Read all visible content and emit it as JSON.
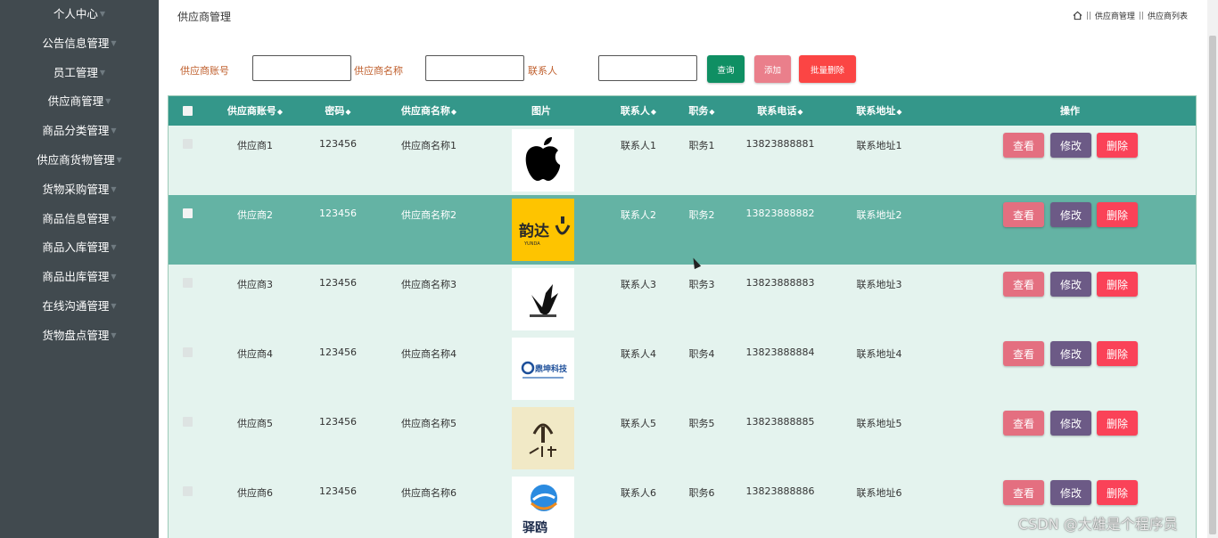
{
  "colors": {
    "sidebar": "#414a4f",
    "header": "#34978a",
    "row_light": "#e4f3ee",
    "row_hover": "#64b3a4",
    "view": "#e46f80",
    "edit": "#6c5a86",
    "delete": "#fa4258",
    "query": "#0f8f63",
    "add": "#ea7f8b",
    "batch_delete": "#fb4544"
  },
  "sidebar": {
    "items": [
      {
        "label": "个人中心"
      },
      {
        "label": "公告信息管理"
      },
      {
        "label": "员工管理"
      },
      {
        "label": "供应商管理"
      },
      {
        "label": "商品分类管理"
      },
      {
        "label": "供应商货物管理"
      },
      {
        "label": "货物采购管理"
      },
      {
        "label": "商品信息管理"
      },
      {
        "label": "商品入库管理"
      },
      {
        "label": "商品出库管理"
      },
      {
        "label": "在线沟通管理"
      },
      {
        "label": "货物盘点管理"
      }
    ]
  },
  "header": {
    "title": "供应商管理",
    "breadcrumb": [
      "供应商管理",
      "供应商列表"
    ],
    "home_icon": "home-icon"
  },
  "search": {
    "account_label": "供应商账号",
    "name_label": "供应商名称",
    "contact_label": "联系人",
    "account_value": "",
    "name_value": "",
    "contact_value": "",
    "query": "查询",
    "add": "添加",
    "batch_delete": "批量删除"
  },
  "table": {
    "columns": [
      "供应商账号",
      "密码",
      "供应商名称",
      "图片",
      "联系人",
      "职务",
      "联系电话",
      "联系地址",
      "操作"
    ],
    "actions": {
      "view": "查看",
      "edit": "修改",
      "delete": "删除"
    },
    "rows": [
      {
        "account": "供应商1",
        "password": "123456",
        "name": "供应商名称1",
        "logo": "apple-logo",
        "contact": "联系人1",
        "title": "职务1",
        "phone": "13823888881",
        "address": "联系地址1"
      },
      {
        "account": "供应商2",
        "password": "123456",
        "name": "供应商名称2",
        "logo": "yunda-logo",
        "logo_text": "韵达",
        "contact": "联系人2",
        "title": "职务2",
        "phone": "13823888882",
        "address": "联系地址2"
      },
      {
        "account": "供应商3",
        "password": "123456",
        "name": "供应商名称3",
        "logo": "bird-logo",
        "contact": "联系人3",
        "title": "职务3",
        "phone": "13823888883",
        "address": "联系地址3"
      },
      {
        "account": "供应商4",
        "password": "123456",
        "name": "供应商名称4",
        "logo": "tech-logo",
        "logo_text": "鼎坤科技",
        "contact": "联系人4",
        "title": "职务4",
        "phone": "13823888884",
        "address": "联系地址4"
      },
      {
        "account": "供应商5",
        "password": "123456",
        "name": "供应商名称5",
        "logo": "tower-logo",
        "contact": "联系人5",
        "title": "职务5",
        "phone": "13823888885",
        "address": "联系地址5"
      },
      {
        "account": "供应商6",
        "password": "123456",
        "name": "供应商名称6",
        "logo": "gull-logo",
        "logo_text": "驿鸥",
        "contact": "联系人6",
        "title": "职务6",
        "phone": "13823888886",
        "address": "联系地址6"
      }
    ]
  },
  "watermark": "CSDN @大雄是个程序员"
}
